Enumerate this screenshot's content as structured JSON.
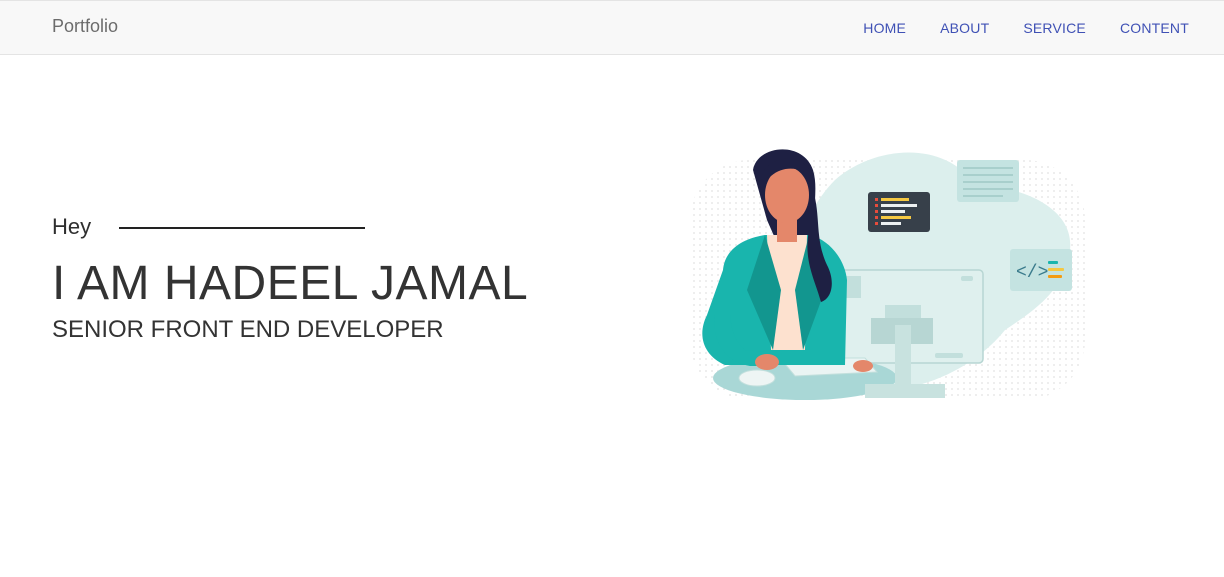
{
  "navbar": {
    "brand": "Portfolio",
    "links": [
      "HOME",
      "ABOUT",
      "SERVICE",
      "CONTENT"
    ]
  },
  "hero": {
    "greeting": "Hey",
    "name": "I AM HADEEL JAMAL",
    "role": "SENIOR FRONT END DEVELOPER"
  },
  "colors": {
    "nav_link": "#3f51b5",
    "blazer": "#19b5ad",
    "blob": "#dcefed"
  },
  "illustration": {
    "icon": "developer-at-computer-illustration"
  }
}
